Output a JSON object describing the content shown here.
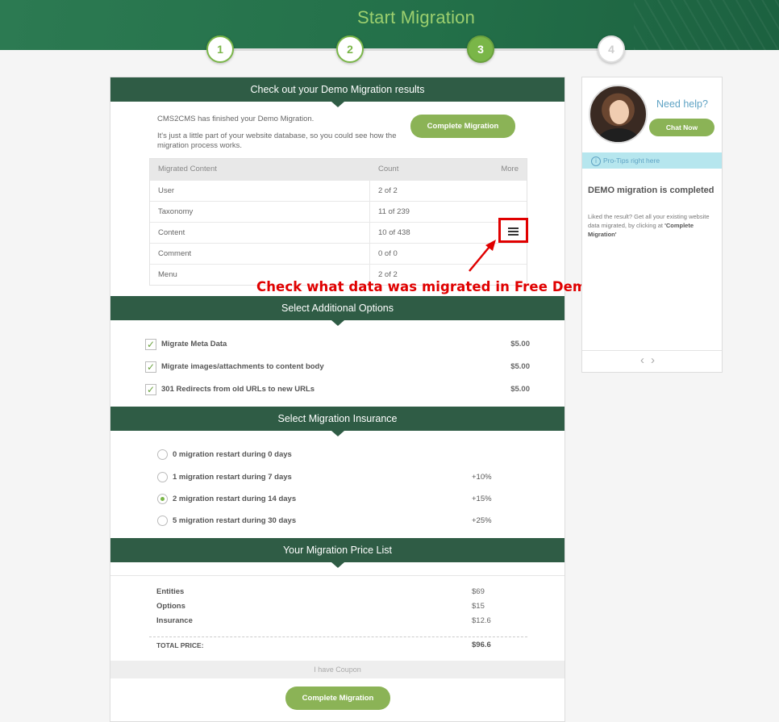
{
  "header": {
    "title": "Start Migration"
  },
  "steps": [
    "1",
    "2",
    "3",
    "4"
  ],
  "results": {
    "title": "Check out your Demo Migration results",
    "intro_line1": "CMS2CMS has finished your Demo Migration.",
    "intro_line2": "It's just a little part of your website database, so you could see how the migration process works.",
    "complete_button": "Complete Migration",
    "table": {
      "headers": {
        "content": "Migrated Content",
        "count": "Count",
        "more": "More"
      },
      "rows": [
        {
          "name": "User",
          "count": "2 of 2"
        },
        {
          "name": "Taxonomy",
          "count": "11 of 239"
        },
        {
          "name": "Content",
          "count": "10 of 438"
        },
        {
          "name": "Comment",
          "count": "0 of 0"
        },
        {
          "name": "Menu",
          "count": "2 of 2"
        }
      ]
    }
  },
  "annotation": {
    "text": "Check what data was migrated in Free Demo",
    "color": "#e00000"
  },
  "options": {
    "title": "Select Additional Options",
    "items": [
      {
        "label": "Migrate Meta Data",
        "price": "$5.00",
        "checked": true
      },
      {
        "label": "Migrate images/attachments to content body",
        "price": "$5.00",
        "checked": true
      },
      {
        "label": "301 Redirects from old URLs to new URLs",
        "price": "$5.00",
        "checked": true
      }
    ]
  },
  "insurance": {
    "title": "Select Migration Insurance",
    "items": [
      {
        "label": "0 migration restart during 0 days",
        "extra": "",
        "checked": false
      },
      {
        "label": "1 migration restart during 7 days",
        "extra": "+10%",
        "checked": false
      },
      {
        "label": "2 migration restart during 14 days",
        "extra": "+15%",
        "checked": true
      },
      {
        "label": "5 migration restart during 30 days",
        "extra": "+25%",
        "checked": false
      }
    ]
  },
  "pricelist": {
    "title": "Your Migration Price List",
    "entities_label": "Entities",
    "entities_value": "$69",
    "options_label": "Options",
    "options_value": "$15",
    "insurance_label": "Insurance",
    "insurance_value": "$12.6",
    "total_label": "TOTAL PRICE:",
    "total_value": "$96.6",
    "coupon": "I have Coupon",
    "complete_button": "Complete Migration"
  },
  "sidebar": {
    "need_help": "Need help?",
    "chat_button": "Chat Now",
    "pro_tips": "Pro-Tips right here",
    "tip_title": "DEMO migration is completed",
    "tip_text": "Liked the result? Get all your existing website data migrated, by clicking at",
    "tip_link": "'Complete Migration'"
  },
  "colors": {
    "brand_green": "#8bb356",
    "header_green": "#2f5c45",
    "accent_blue": "#5fa3c4"
  }
}
